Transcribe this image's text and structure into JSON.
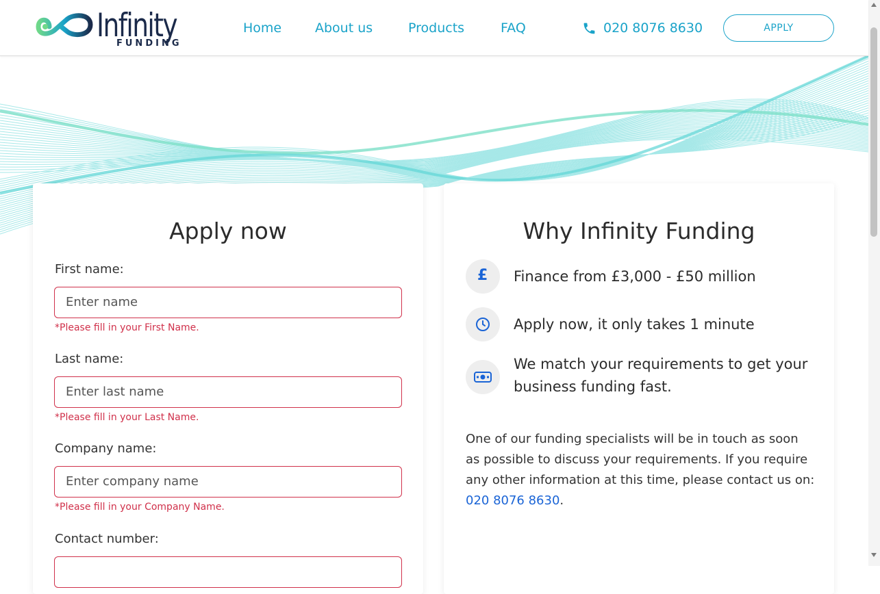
{
  "brand": {
    "name": "Infinity",
    "sub": "FUNDING"
  },
  "nav": {
    "items": [
      {
        "label": "Home"
      },
      {
        "label": "About us"
      },
      {
        "label": "Products"
      },
      {
        "label": "FAQ"
      }
    ],
    "phone": "020 8076 8630",
    "apply_label": "APPLY"
  },
  "colors": {
    "accent": "#1aa3c9",
    "error": "#d0304a",
    "link": "#1a64d6",
    "brand_navy": "#1b2a4a",
    "wave": "#5fd6d6"
  },
  "form": {
    "title": "Apply now",
    "fields": [
      {
        "label": "First name:",
        "placeholder": "Enter name",
        "error": "*Please fill in your First Name."
      },
      {
        "label": "Last name:",
        "placeholder": "Enter last name",
        "error": "*Please fill in your Last Name."
      },
      {
        "label": "Company name:",
        "placeholder": "Enter company name",
        "error": "*Please fill in your Company Name."
      },
      {
        "label": "Contact number:",
        "placeholder": "",
        "error": ""
      }
    ]
  },
  "why": {
    "title": "Why Infinity Funding",
    "items": [
      {
        "icon": "pound-icon",
        "glyph": "£",
        "text": "Finance from £3,000 - £50 million"
      },
      {
        "icon": "clock-icon",
        "text": "Apply now, it only takes 1 minute"
      },
      {
        "icon": "banknote-icon",
        "text": "We match your requirements to get your business funding fast."
      }
    ],
    "paragraph": "One of our funding specialists will be in touch as soon as possible to discuss your requirements. If you require any other information at this time, please contact us on:",
    "phone_link": "020 8076 8630",
    "trailing": "."
  }
}
